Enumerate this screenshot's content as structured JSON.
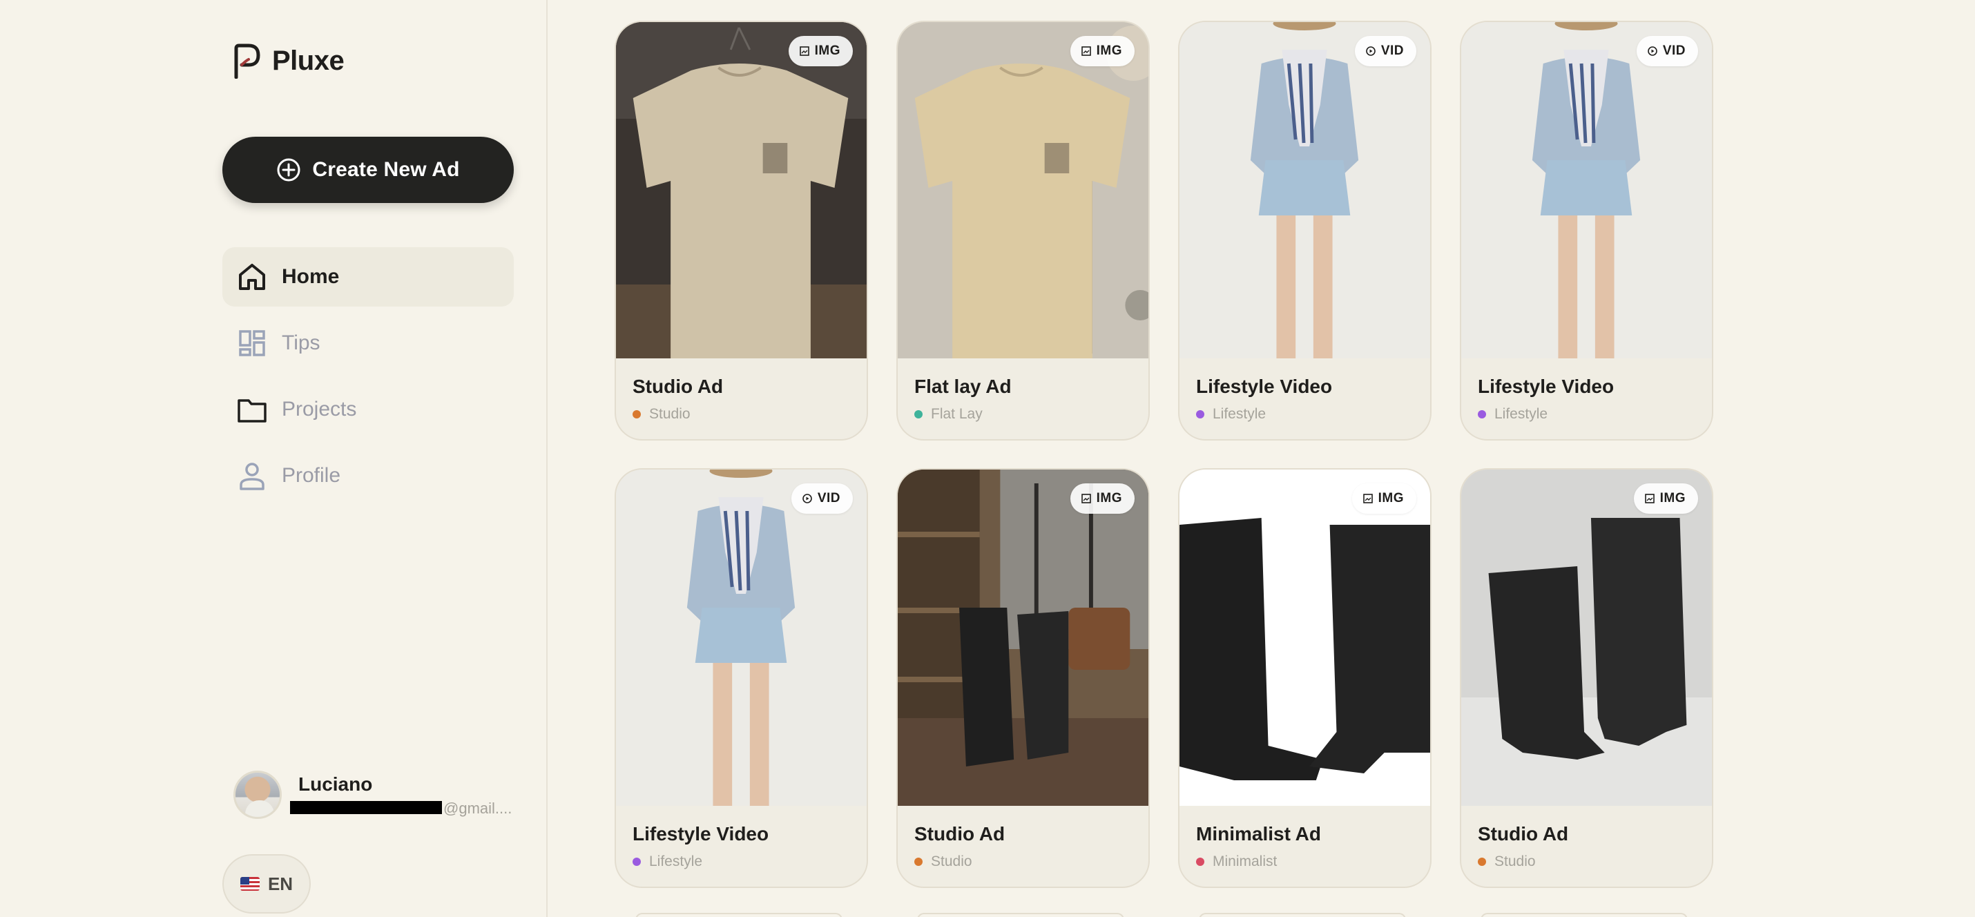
{
  "app": {
    "name": "Pluxe"
  },
  "sidebar": {
    "create_label": "Create New Ad",
    "nav": [
      {
        "label": "Home",
        "icon": "home-icon",
        "active": true
      },
      {
        "label": "Tips",
        "icon": "dashboard-icon",
        "active": false
      },
      {
        "label": "Projects",
        "icon": "folder-icon",
        "active": false
      },
      {
        "label": "Profile",
        "icon": "person-icon",
        "active": false
      }
    ],
    "user": {
      "name": "Luciano",
      "email_suffix": "@gmail...."
    },
    "language": {
      "code": "EN",
      "flag": "us-flag-icon"
    }
  },
  "colors": {
    "studio": "#d9792f",
    "flat_lay": "#3fb39b",
    "lifestyle": "#9a5be0",
    "minimalist": "#d94b63",
    "dark_button": "#232321",
    "background": "#f6f3ea"
  },
  "cards": [
    {
      "title": "Studio Ad",
      "category": "Studio",
      "badge": "IMG"
    },
    {
      "title": "Flat lay Ad",
      "category": "Flat Lay",
      "badge": "IMG"
    },
    {
      "title": "Lifestyle Video",
      "category": "Lifestyle",
      "badge": "VID"
    },
    {
      "title": "Lifestyle Video",
      "category": "Lifestyle",
      "badge": "VID"
    },
    {
      "title": "Lifestyle Video",
      "category": "Lifestyle",
      "badge": "VID"
    },
    {
      "title": "Studio Ad",
      "category": "Studio",
      "badge": "IMG"
    },
    {
      "title": "Minimalist Ad",
      "category": "Minimalist",
      "badge": "IMG"
    },
    {
      "title": "Studio Ad",
      "category": "Studio",
      "badge": "IMG"
    }
  ]
}
